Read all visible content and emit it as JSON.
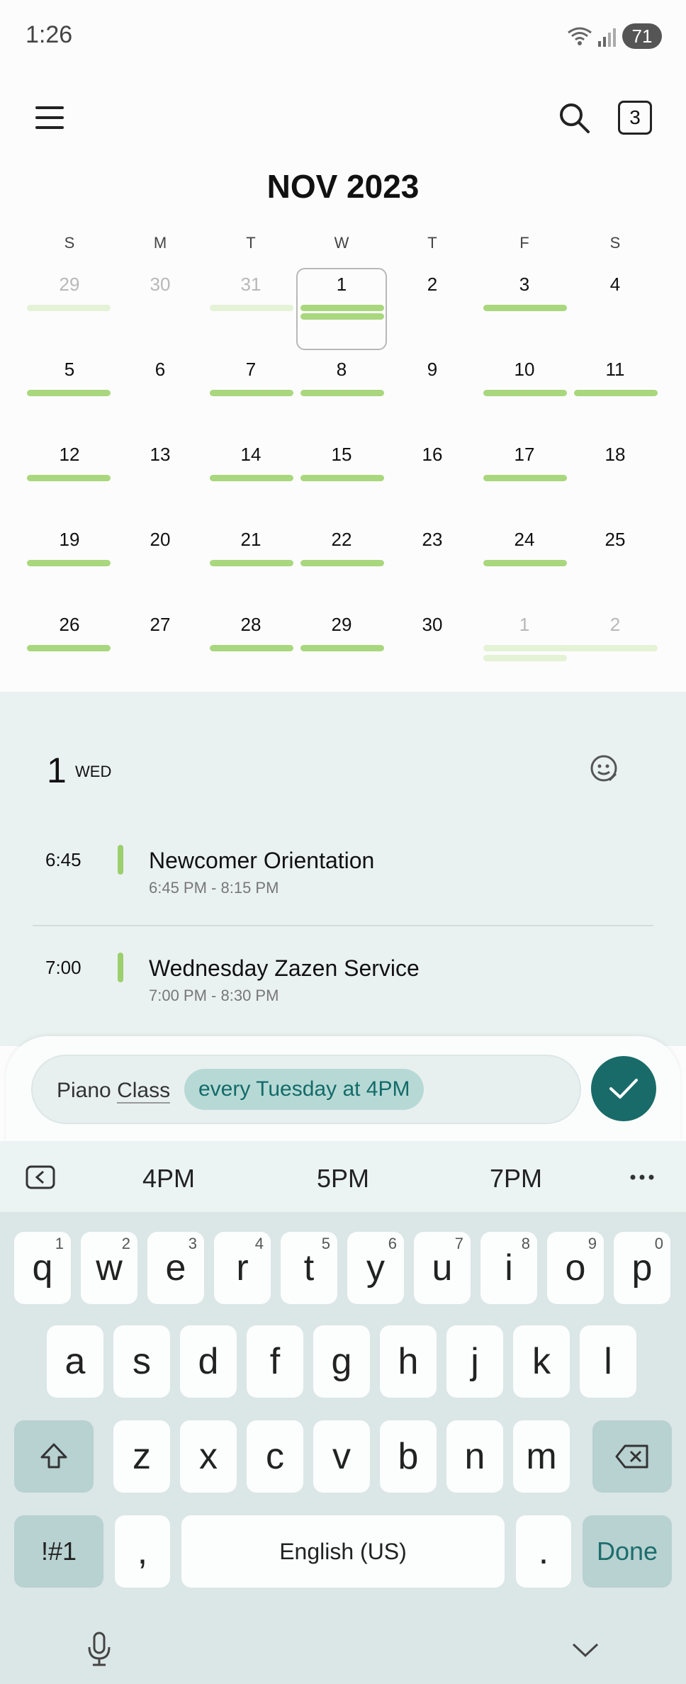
{
  "status_bar": {
    "time": "1:26",
    "battery": "71"
  },
  "header": {
    "title": "NOV 2023",
    "today_badge": "3"
  },
  "calendar": {
    "weekdays": [
      "S",
      "M",
      "T",
      "W",
      "T",
      "F",
      "S"
    ],
    "weeks": [
      [
        "29",
        "30",
        "31",
        "1",
        "2",
        "3",
        "4"
      ],
      [
        "5",
        "6",
        "7",
        "8",
        "9",
        "10",
        "11"
      ],
      [
        "12",
        "13",
        "14",
        "15",
        "16",
        "17",
        "18"
      ],
      [
        "19",
        "20",
        "21",
        "22",
        "23",
        "24",
        "25"
      ],
      [
        "26",
        "27",
        "28",
        "29",
        "30",
        "1",
        "2"
      ]
    ]
  },
  "agenda": {
    "day_number": "1",
    "day_of_week": "WED",
    "events": [
      {
        "time": "6:45",
        "title": "Newcomer Orientation",
        "range": "6:45 PM - 8:15 PM"
      },
      {
        "time": "7:00",
        "title": "Wednesday Zazen Service",
        "range": "7:00 PM - 8:30 PM"
      }
    ]
  },
  "quick_add": {
    "text_prefix": "Piano ",
    "text_word": "Class",
    "chip": "every Tuesday at 4PM"
  },
  "keyboard": {
    "suggestions": [
      "4PM",
      "5PM",
      "7PM"
    ],
    "row1": [
      {
        "k": "q",
        "n": "1"
      },
      {
        "k": "w",
        "n": "2"
      },
      {
        "k": "e",
        "n": "3"
      },
      {
        "k": "r",
        "n": "4"
      },
      {
        "k": "t",
        "n": "5"
      },
      {
        "k": "y",
        "n": "6"
      },
      {
        "k": "u",
        "n": "7"
      },
      {
        "k": "i",
        "n": "8"
      },
      {
        "k": "o",
        "n": "9"
      },
      {
        "k": "p",
        "n": "0"
      }
    ],
    "row2": [
      "a",
      "s",
      "d",
      "f",
      "g",
      "h",
      "j",
      "k",
      "l"
    ],
    "row3": [
      "z",
      "x",
      "c",
      "v",
      "b",
      "n",
      "m"
    ],
    "symbols_label": "!#1",
    "comma_label": ",",
    "space_label": "English (US)",
    "period_label": ".",
    "done_label": "Done"
  },
  "colors": {
    "accent": "#196b69",
    "event_bar": "#a9d77d",
    "chip_bg": "#b7d9d6"
  }
}
